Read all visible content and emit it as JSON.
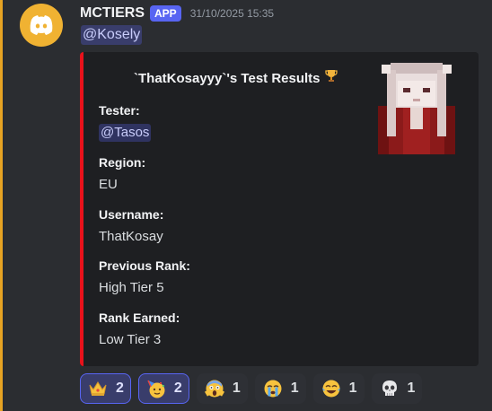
{
  "message": {
    "author": "MCTIERS",
    "badge": "APP",
    "timestamp": "31/10/2025 15:35",
    "mention": "@Kosely"
  },
  "embed": {
    "accent_color": "#e8121b",
    "title": "`ThatKosayyy`'s Test Results",
    "title_icon": "trophy-icon",
    "fields": [
      {
        "name": "Tester:",
        "value": "@Tasos",
        "is_mention": true
      },
      {
        "name": "Region:",
        "value": "EU"
      },
      {
        "name": "Username:",
        "value": "ThatKosay"
      },
      {
        "name": "Previous Rank:",
        "value": "High Tier 5"
      },
      {
        "name": "Rank Earned:",
        "value": "Low Tier 3"
      }
    ]
  },
  "reactions": [
    {
      "icon": "crown-emoji",
      "count": "2",
      "active": true
    },
    {
      "icon": "partying-face-emoji",
      "count": "2",
      "active": true
    },
    {
      "icon": "screaming-face-emoji",
      "count": "1",
      "active": false
    },
    {
      "icon": "crying-face-emoji",
      "count": "1",
      "active": false
    },
    {
      "icon": "tears-of-joy-emoji",
      "count": "1",
      "active": false
    },
    {
      "icon": "skull-emoji",
      "count": "1",
      "active": false
    }
  ]
}
